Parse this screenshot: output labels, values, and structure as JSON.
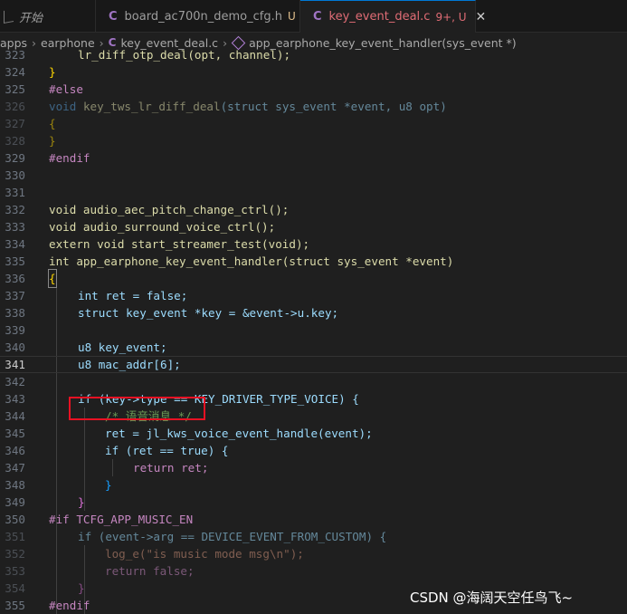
{
  "tabs": [
    {
      "label": "开始"
    },
    {
      "label": "board_ac700n_demo_cfg.h",
      "badge": "U"
    },
    {
      "label": "key_event_deal.c",
      "badge": "9+, U"
    }
  ],
  "breadcrumb": {
    "apps": "apps",
    "earphone": "earphone",
    "file": "key_event_deal.c",
    "symbol": "app_earphone_key_event_handler(sys_event *)"
  },
  "code": {
    "l323": "lr_diff_otp_deal(opt, channel);",
    "l324": "}",
    "l325": "#else",
    "l326_void": "void",
    "l326_fn": "key_tws_lr_diff_deal",
    "l326_args": "(struct sys_event *event, u8 opt)",
    "l327": "{",
    "l328": "}",
    "l329": "#endif",
    "l332": "void audio_aec_pitch_change_ctrl();",
    "l333": "void audio_surround_voice_ctrl();",
    "l334": "extern void start_streamer_test(void);",
    "l335": "int app_earphone_key_event_handler(struct sys_event *event)",
    "l336": "{",
    "l337": "int ret = false;",
    "l338": "struct key_event *key = &event->u.key;",
    "l340": "u8 key_event;",
    "l341": "u8 mac_addr[6];",
    "l343": "if (key->type == KEY_DRIVER_TYPE_VOICE) {",
    "l344": "/* 语音消息 */",
    "l345": "ret = jl_kws_voice_event_handle(event);",
    "l346": "if (ret == true) {",
    "l347": "return ret;",
    "l348": "}",
    "l349": "}",
    "l350": "#if TCFG_APP_MUSIC_EN",
    "l351": "if (event->arg == DEVICE_EVENT_FROM_CUSTOM) {",
    "l352": "log_e(\"is music mode msg\\n\");",
    "l353": "return false;",
    "l354": "}",
    "l355": "#endif"
  },
  "line_numbers": [
    "323",
    "324",
    "325",
    "326",
    "327",
    "328",
    "329",
    "330",
    "331",
    "332",
    "333",
    "334",
    "335",
    "336",
    "337",
    "338",
    "339",
    "340",
    "341",
    "342",
    "343",
    "344",
    "345",
    "346",
    "347",
    "348",
    "349",
    "350",
    "351",
    "352",
    "353",
    "354",
    "355"
  ],
  "watermark": "CSDN @海阔天空任鸟飞~",
  "colors": {
    "highlight_box": "#e81123",
    "modified": "#e06c75"
  }
}
